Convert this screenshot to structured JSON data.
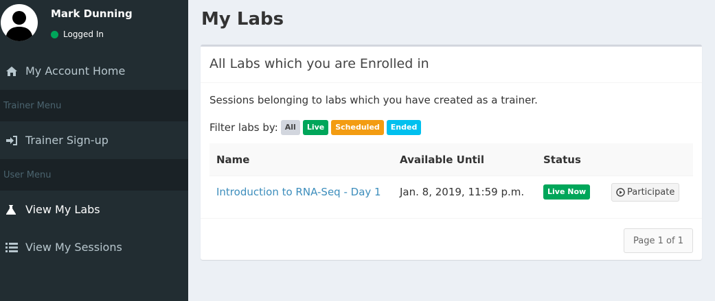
{
  "user": {
    "name": "Mark Dunning",
    "status": "Logged In"
  },
  "sidebar": {
    "account_home": "My Account Home",
    "trainer_header": "Trainer Menu",
    "trainer_signup": "Trainer Sign-up",
    "user_header": "User Menu",
    "view_labs": "View My Labs",
    "view_sessions": "View My Sessions"
  },
  "page": {
    "title": "My Labs"
  },
  "box": {
    "title": "All Labs which you are Enrolled in",
    "description": "Sessions belonging to labs which you have created as a trainer.",
    "filter_label": "Filter labs by:",
    "filters": {
      "all": "All",
      "live": "Live",
      "scheduled": "Scheduled",
      "ended": "Ended"
    },
    "columns": {
      "name": "Name",
      "available": "Available Until",
      "status": "Status"
    },
    "rows": [
      {
        "name": "Introduction to RNA-Seq - Day 1",
        "available": "Jan. 8, 2019, 11:59 p.m.",
        "status": "Live Now",
        "action": "Participate"
      }
    ],
    "pagination": "Page 1 of 1"
  },
  "colors": {
    "sidebar_bg": "#222d32",
    "live": "#00a65a",
    "scheduled": "#f39c12",
    "ended": "#00c0ef",
    "link": "#3c8dbc"
  }
}
